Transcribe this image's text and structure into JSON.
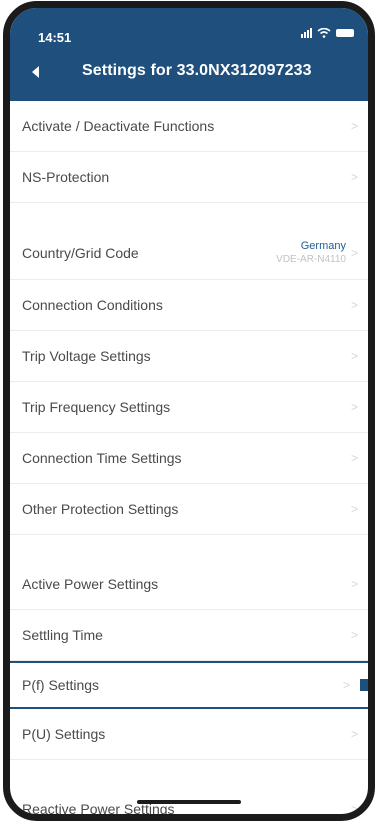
{
  "status_bar": {
    "time": "14:51"
  },
  "header": {
    "title": "Settings for 33.0NX312097233"
  },
  "items": [
    {
      "label": "Activate / Deactivate Functions"
    },
    {
      "label": "NS-Protection"
    },
    {
      "label": "Country/Grid Code",
      "value": "Germany",
      "subvalue": "VDE-AR-N4110"
    },
    {
      "label": "Connection Conditions"
    },
    {
      "label": "Trip Voltage Settings"
    },
    {
      "label": "Trip Frequency Settings"
    },
    {
      "label": "Connection Time Settings"
    },
    {
      "label": "Other Protection Settings"
    },
    {
      "label": "Active Power Settings"
    },
    {
      "label": "Settling Time"
    },
    {
      "label": "P(f) Settings"
    },
    {
      "label": "P(U) Settings"
    },
    {
      "label": "Reactive Power Settings"
    }
  ],
  "icons": {
    "back": "back-arrow-icon",
    "chevron": "chevron-right-icon",
    "signal": "signal-icon",
    "wifi": "wifi-icon",
    "battery": "battery-icon"
  },
  "colors": {
    "header_bg": "#1f4f7c",
    "accent": "#1f5e97"
  }
}
